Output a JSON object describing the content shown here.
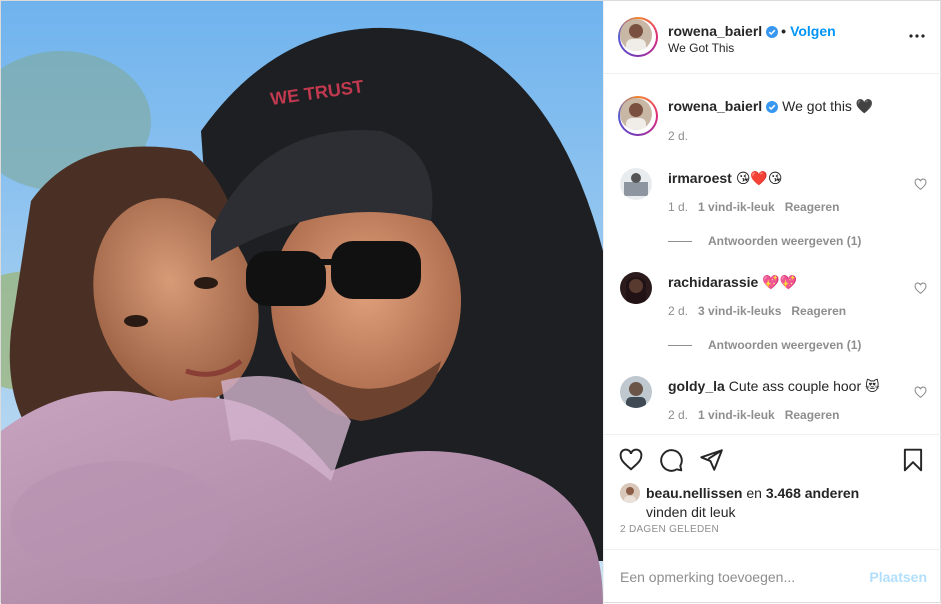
{
  "post": {
    "photo_icon": "couple-selfie-photo",
    "cap_text": "WE TRUST"
  },
  "header": {
    "username": "rowena_baierl",
    "dot": "•",
    "follow_label": "Volgen",
    "location": "We Got This"
  },
  "caption": {
    "username": "rowena_baierl",
    "text": "We got this 🖤",
    "time": "2 d."
  },
  "comments": [
    {
      "username": "irmaroest",
      "text": "😘❤️😘",
      "time": "1 d.",
      "likes": "1 vind-ik-leuk",
      "reply": "Reageren",
      "view_replies": "Antwoorden weergeven (1)"
    },
    {
      "username": "rachidarassie",
      "text": "💖💖",
      "time": "2 d.",
      "likes": "3 vind-ik-leuks",
      "reply": "Reageren",
      "view_replies": "Antwoorden weergeven (1)"
    },
    {
      "username": "goldy_la",
      "text": "Cute ass couple hoor 😻",
      "time": "2 d.",
      "likes": "1 vind-ik-leuk",
      "reply": "Reageren"
    }
  ],
  "actions": {
    "liked_by_user": "beau.nellissen",
    "and_text": " en ",
    "others": "3.468 anderen",
    "likes_suffix": "vinden dit leuk",
    "date": "2 DAGEN GELEDEN"
  },
  "add_comment": {
    "placeholder": "Een opmerking toevoegen...",
    "post_label": "Plaatsen"
  },
  "colors": {
    "link_blue": "#0095f6",
    "disabled_blue": "#b2dffc",
    "muted_gray": "#8e8e8e",
    "text": "#262626"
  }
}
